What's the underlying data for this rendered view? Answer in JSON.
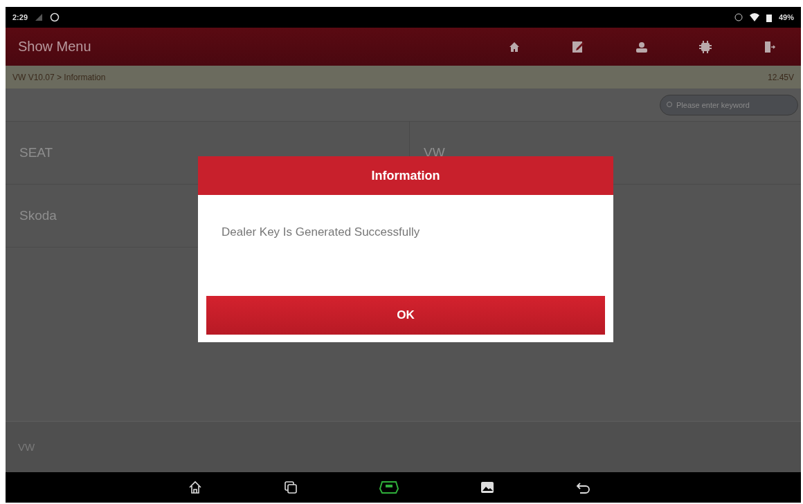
{
  "status_bar": {
    "time": "2:29",
    "battery": "49%"
  },
  "header": {
    "title": "Show Menu"
  },
  "breadcrumb": {
    "path": "VW V10.07 > Information",
    "voltage": "12.45V"
  },
  "search": {
    "placeholder": "Please enter keyword"
  },
  "brands": [
    {
      "label": "SEAT"
    },
    {
      "label": "VW"
    },
    {
      "label": "Skoda"
    }
  ],
  "footer": {
    "label": "VW"
  },
  "dialog": {
    "title": "Information",
    "message": "Dealer Key Is Generated Successfully",
    "button": "OK"
  }
}
